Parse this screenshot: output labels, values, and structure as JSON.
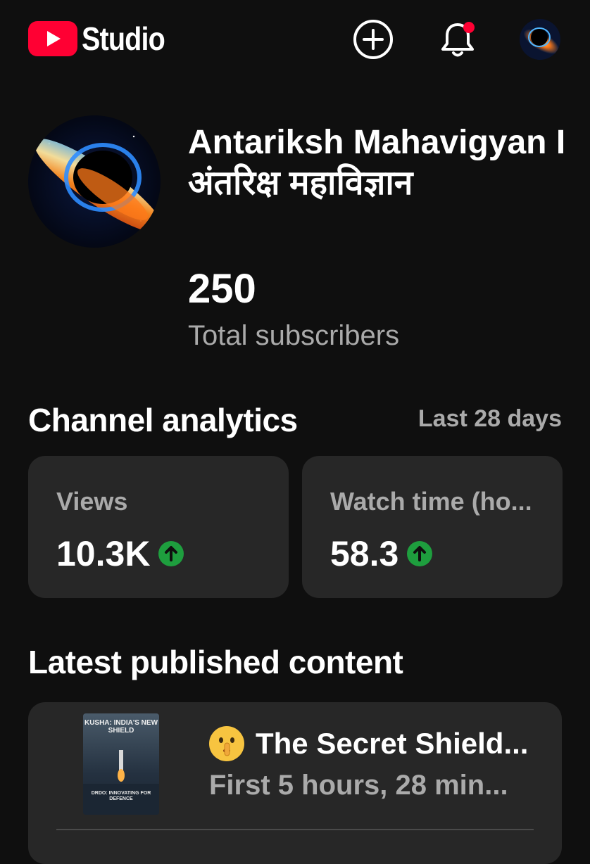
{
  "app": {
    "title": "Studio"
  },
  "channel": {
    "name": "Antariksh Mahavigyan I अंतरिक्ष महाविज्ञान",
    "subscribers": "250",
    "subscribers_label": "Total subscribers"
  },
  "analytics": {
    "title": "Channel analytics",
    "period": "Last 28 days",
    "cards": [
      {
        "label": "Views",
        "value": "10.3K",
        "trend_icon": "arrow-up-icon"
      },
      {
        "label": "Watch time (ho...",
        "value": "58.3",
        "trend_icon": "arrow-up-icon"
      }
    ]
  },
  "latest": {
    "title": "Latest published content",
    "video": {
      "title": "The Secret Shield...",
      "meta": "First 5 hours, 28 min...",
      "emoji": "shushing-face-emoji",
      "thumbnail_text_top": "KUSHA: INDIA'S NEW SHIELD",
      "thumbnail_text_bottom": "DRDO: INNOVATING FOR DEFENCE"
    }
  },
  "colors": {
    "background": "#0f0f0f",
    "card": "#272727",
    "accent_red": "#ff0033",
    "trend_green": "#1e9e3e",
    "notification_dot": "#ff0033"
  },
  "icons": {
    "create": "plus-circle-icon",
    "notifications": "bell-icon"
  }
}
